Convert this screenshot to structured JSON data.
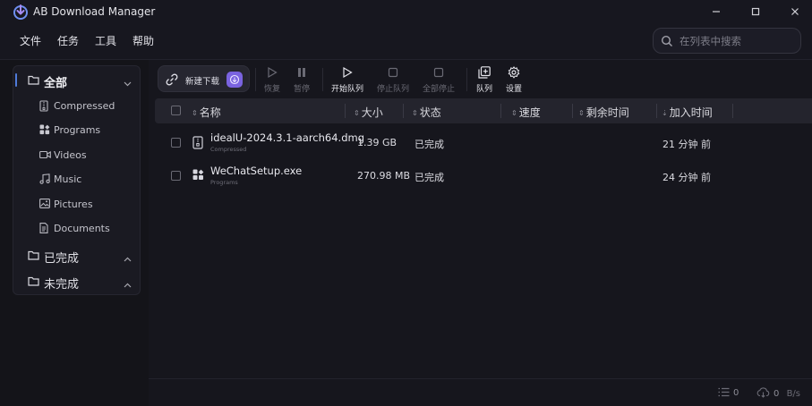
{
  "app": {
    "title": "AB Download Manager"
  },
  "menu": [
    "文件",
    "任务",
    "工具",
    "帮助"
  ],
  "search": {
    "placeholder": "在列表中搜索"
  },
  "sidebar": {
    "categories": [
      {
        "label": "全部",
        "expanded": true,
        "active": true,
        "children": [
          {
            "label": "Compressed",
            "icon": "archive-icon"
          },
          {
            "label": "Programs",
            "icon": "apps-icon"
          },
          {
            "label": "Videos",
            "icon": "video-icon"
          },
          {
            "label": "Music",
            "icon": "music-icon"
          },
          {
            "label": "Pictures",
            "icon": "image-icon"
          },
          {
            "label": "Documents",
            "icon": "document-icon"
          }
        ]
      },
      {
        "label": "已完成",
        "expanded": false
      },
      {
        "label": "未完成",
        "expanded": false
      }
    ]
  },
  "toolbar": {
    "new_download": "新建下载",
    "resume": "恢复",
    "pause": "暂停",
    "start_queue": "开始队列",
    "stop_queue": "停止队列",
    "stop_all": "全部停止",
    "queue": "队列",
    "settings": "设置"
  },
  "table": {
    "columns": [
      "名称",
      "大小",
      "状态",
      "速度",
      "剩余时间",
      "加入时间"
    ],
    "rows": [
      {
        "name": "idealU-2024.3.1-aarch64.dmg",
        "category": "Compressed",
        "icon": "archive-icon",
        "size": "1.39 GB",
        "status": "已完成",
        "speed": "",
        "remaining": "",
        "added": "21 分钟 前"
      },
      {
        "name": "WeChatSetup.exe",
        "category": "Programs",
        "icon": "apps-icon",
        "size": "270.98 MB",
        "status": "已完成",
        "speed": "",
        "remaining": "",
        "added": "24 分钟 前"
      }
    ]
  },
  "status_bar": {
    "active_count": "0",
    "speed": "0",
    "speed_unit": "B/s"
  },
  "colors": {
    "accent": "#4f7bd9",
    "badge": "#7a63e0",
    "background": "#17171f"
  }
}
